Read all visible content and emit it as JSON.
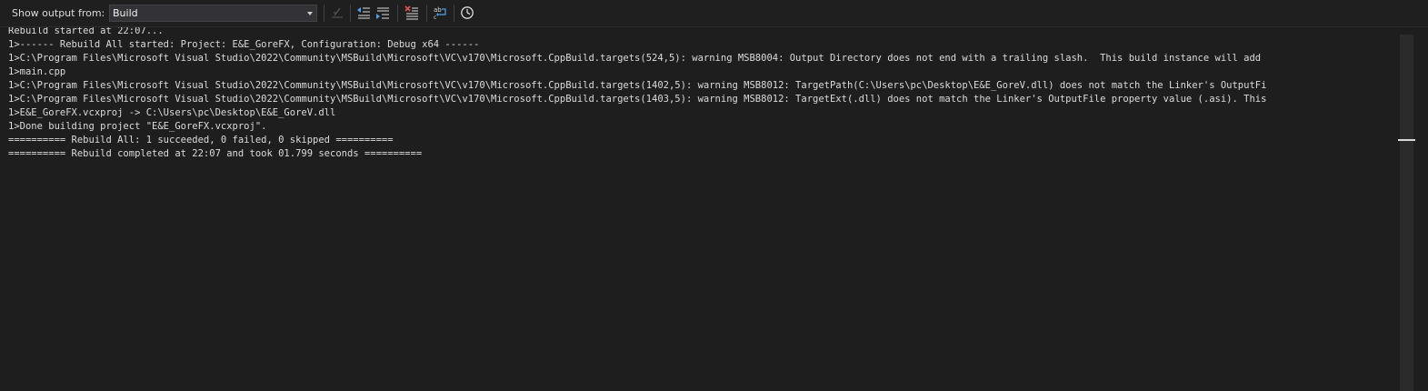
{
  "toolbar": {
    "show_output_label": "Show output from:",
    "source_value": "Build",
    "buttons": [
      {
        "name": "go-to-error-button",
        "icon": "go-to-line-icon"
      },
      {
        "name": "previous-message-button",
        "icon": "previous-message-icon"
      },
      {
        "name": "next-message-button",
        "icon": "next-message-icon"
      },
      {
        "name": "clear-all-button",
        "icon": "clear-all-icon"
      },
      {
        "name": "toggle-word-wrap-button",
        "icon": "word-wrap-icon"
      },
      {
        "name": "show-timestamps-button",
        "icon": "clock-icon"
      }
    ]
  },
  "output": {
    "lines": [
      "Rebuild started at 22:07...",
      "1>------ Rebuild All started: Project: E&E_GoreFX, Configuration: Debug x64 ------",
      "1>C:\\Program Files\\Microsoft Visual Studio\\2022\\Community\\MSBuild\\Microsoft\\VC\\v170\\Microsoft.CppBuild.targets(524,5): warning MSB8004: Output Directory does not end with a trailing slash.  This build instance will add",
      "1>main.cpp",
      "1>C:\\Program Files\\Microsoft Visual Studio\\2022\\Community\\MSBuild\\Microsoft\\VC\\v170\\Microsoft.CppBuild.targets(1402,5): warning MSB8012: TargetPath(C:\\Users\\pc\\Desktop\\E&E_GoreV.dll) does not match the Linker's OutputFi",
      "1>C:\\Program Files\\Microsoft Visual Studio\\2022\\Community\\MSBuild\\Microsoft\\VC\\v170\\Microsoft.CppBuild.targets(1403,5): warning MSB8012: TargetExt(.dll) does not match the Linker's OutputFile property value (.asi). This",
      "1>E&E_GoreFX.vcxproj -> C:\\Users\\pc\\Desktop\\E&E_GoreV.dll",
      "1>Done building project \"E&E_GoreFX.vcxproj\".",
      "========== Rebuild All: 1 succeeded, 0 failed, 0 skipped ==========",
      "========== Rebuild completed at 22:07 and took 01.799 seconds =========="
    ]
  }
}
